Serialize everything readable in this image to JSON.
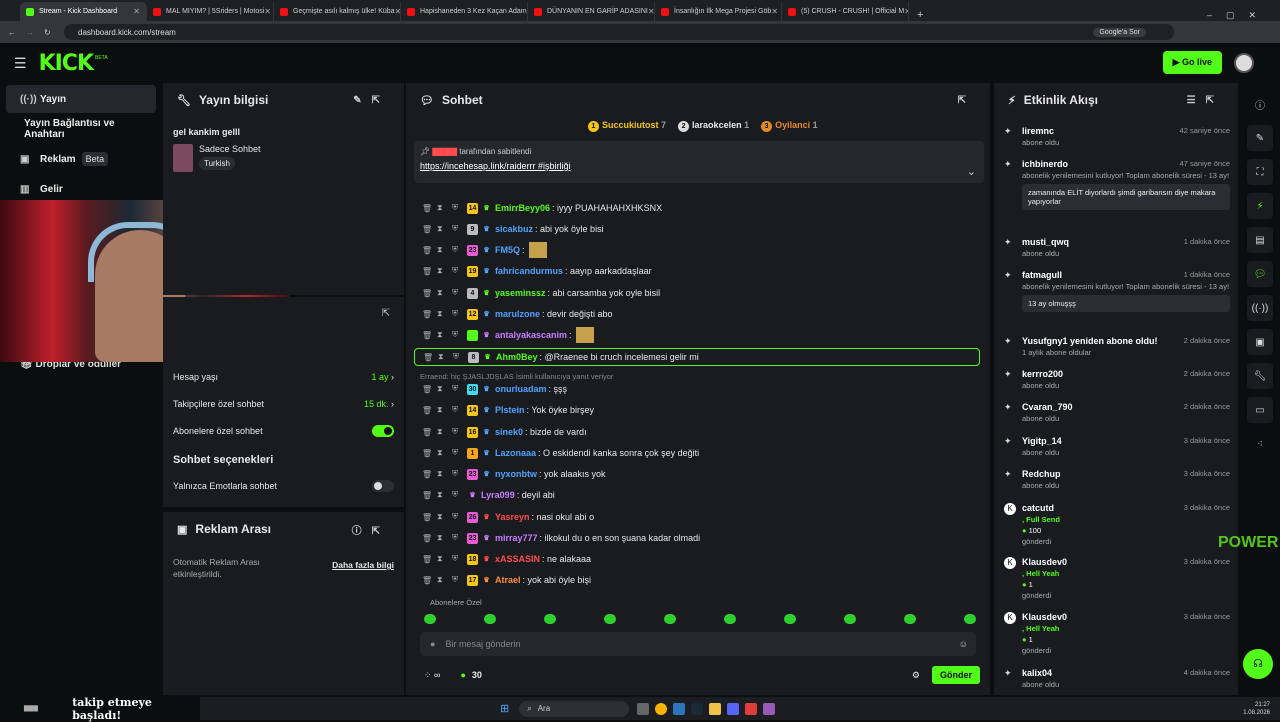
{
  "browser": {
    "tabs": [
      {
        "label": "Stream - Kick Dashboard",
        "active": true
      },
      {
        "label": "MAL MIYIM? | 5Sriders | Motosi"
      },
      {
        "label": "Geçmişte asılı kalmış ülke! Küba"
      },
      {
        "label": "Hapishaneden 3 Kez Kaçan Adam"
      },
      {
        "label": "DÜNYANIN EN GARİP ADASINI"
      },
      {
        "label": "İnsanlığın İlk Mega Projesi Göb"
      },
      {
        "label": "(5) CRUSH - CRUSH! | Official M"
      }
    ],
    "url": "dashboard.kick.com/stream",
    "google_btn": "Google'a Sor"
  },
  "header": {
    "logo": "KICK",
    "logo_sup": "BETA",
    "golive": "Go live"
  },
  "nav": {
    "items": [
      {
        "label": "Yayın",
        "icon": "broadcast-icon"
      },
      {
        "label": "Yayın Bağlantısı ve Anahtarı"
      },
      {
        "label": "Reklam",
        "badge": "Beta",
        "icon": "ad-icon"
      },
      {
        "label": "Gelir",
        "icon": "chart-icon"
      }
    ],
    "drops": "Droplar ve ödüller"
  },
  "stream_info": {
    "title": "Yayın bilgisi",
    "stream_title": "gel kankim gelll",
    "category": "Sadece Sohbet",
    "language": "Turkish"
  },
  "chat_settings": {
    "rows": [
      {
        "label": "Hesap yaşı",
        "value": "1 ay"
      },
      {
        "label": "Takipçilere özel sohbet",
        "value": "15 dk."
      },
      {
        "label": "Abonelere özel sohbet"
      }
    ],
    "section": "Sohbet seçenekleri",
    "emote_only": "Yalnızca Emotlarla sohbet"
  },
  "ad_break": {
    "title": "Reklam Arası",
    "desc": "Otomatik Reklam Arası etkinleştirildi.",
    "link": "Daha fazla bilgi"
  },
  "chat": {
    "title": "Sohbet",
    "top": [
      {
        "rank": "1",
        "name": "Succukiutost",
        "count": "7"
      },
      {
        "rank": "2",
        "name": "laraokcelen",
        "count": "1"
      },
      {
        "rank": "3",
        "name": "Oyilanci",
        "count": "1"
      }
    ],
    "pinned": {
      "by_suffix": "tarafından sabitlendi",
      "text": "https://incehesap.link/raiderrr #işbirliği"
    },
    "messages": [
      {
        "user": "EmirrBeyy06",
        "color": "#53fc18",
        "text": ": iyyy PUAHAHAHXHKSNX",
        "badge": "14",
        "bcol": "#f5c518"
      },
      {
        "user": "sicakbuz",
        "color": "#4fa3ff",
        "text": ": abi yok öyle bisi",
        "badge": "9",
        "bcol": "#bbbbbb"
      },
      {
        "user": "FM5Q",
        "color": "#4fa3ff",
        "text": ":",
        "badge": "23",
        "bcol": "#e85ad6"
      },
      {
        "user": "fahricandurmus",
        "color": "#4fa3ff",
        "text": ": aayıp aarkaddaşlaar",
        "badge": "19",
        "bcol": "#f5c518"
      },
      {
        "user": "yaseminssz",
        "color": "#53fc18",
        "text": ": abi carsamba yok oyle bisil",
        "badge": "4",
        "bcol": "#bbbbbb"
      },
      {
        "user": "marulzone",
        "color": "#4fa3ff",
        "text": ": devir değişti abo",
        "badge": "12",
        "bcol": "#f5c518"
      },
      {
        "user": "antalyakascanim",
        "color": "#c77dff",
        "text": ":",
        "badge": "",
        "bcol": "#53fc18"
      },
      {
        "user": "Ahm0Bey",
        "color": "#53fc18",
        "text": ": @Rraenee bi cruch incelemesi gelir mi",
        "badge": "8",
        "bcol": "#bbbbbb"
      },
      {
        "user": "onurluadam",
        "color": "#4fa3ff",
        "text": ": şşş",
        "badge": "30",
        "bcol": "#3ddcf5"
      },
      {
        "user": "Plstein",
        "color": "#4fa3ff",
        "text": ": Yok öyke birşey",
        "badge": "14",
        "bcol": "#f5c518"
      },
      {
        "user": "sinek0",
        "color": "#4fa3ff",
        "text": ": bizde de vardı",
        "badge": "16",
        "bcol": "#f5c518"
      },
      {
        "user": "Lazonaaa",
        "color": "#4fa3ff",
        "text": ": O eskidendi kanka sonra çok şey değiti",
        "badge": "1",
        "bcol": "#f5a518"
      },
      {
        "user": "nyxonbtw",
        "color": "#4fa3ff",
        "text": ": yok alaakıs yok",
        "badge": "23",
        "bcol": "#e85ad6"
      },
      {
        "user": "Lyra099",
        "color": "#c77dff",
        "text": ": deyil abi",
        "badge": "",
        "bcol": ""
      },
      {
        "user": "Yasreyn",
        "color": "#ff4d4d",
        "text": ": nasi okul abi o",
        "badge": "26",
        "bcol": "#e85ad6"
      },
      {
        "user": "mirray777",
        "color": "#c77dff",
        "text": ": ilkokul du o en son şuana kadar olmadi",
        "badge": "23",
        "bcol": "#e85ad6"
      },
      {
        "user": "xASSASIN",
        "color": "#ff4d4d",
        "text": ": ne alakaaa",
        "badge": "18",
        "bcol": "#f5c518"
      },
      {
        "user": "Atrael",
        "color": "#ff8c3a",
        "text": ": yok abi öyle bişi",
        "badge": "17",
        "bcol": "#f5c518"
      }
    ],
    "reply_note": "Erraend: hiç ŞJASLJDŞLAS İsimli kullanıcıya yanıt veriyor",
    "sub_label": "Abonelere Özel",
    "placeholder": "Bir mesaj gönderin",
    "points": "30",
    "send": "Gönder"
  },
  "activity": {
    "title": "Etkinlik Akışı",
    "items": [
      {
        "name": "liremnc",
        "sub": "abone oldu",
        "time": "42 saniye önce"
      },
      {
        "name": "ichbinerdo",
        "sub": "abonelik yenilemesini kutluyor! Toplam abonelik süresi - 13 ay!",
        "time": "47 saniye önce",
        "note": "zamanında ELİT diyorlardı şimdi garibansın diye makara yapıyorlar"
      },
      {
        "name": "musti_qwq",
        "sub": "abone oldu",
        "time": "1 dakika önce"
      },
      {
        "name": "fatmagull",
        "sub": "abonelik yenilemesini kutluyor! Toplam abonelik süresi - 13 ay!",
        "time": "1 dakika önce",
        "note": "13 ay olmuşşş"
      },
      {
        "name": "Yusufgny1 yeniden abone oldu!",
        "sub": "1 aylık abone oldular",
        "time": "2 dakika önce"
      },
      {
        "name": "kerrro200",
        "sub": "abone oldu",
        "time": "2 dakika önce"
      },
      {
        "name": "Cvaran_790",
        "sub": "abone oldu",
        "time": "2 dakika önce"
      },
      {
        "name": "Yigitp_14",
        "sub": "abone oldu",
        "time": "3 dakika önce"
      },
      {
        "name": "Redchup",
        "sub": "abone oldu",
        "time": "3 dakika önce"
      },
      {
        "name": "catcutd",
        "sub": ", Full Send",
        "sub2": "100",
        "sub3": "gönderdi",
        "time": "3 dakika önce"
      },
      {
        "name": "Klausdev0",
        "sub": ", Hell Yeah",
        "sub2": "1",
        "sub3": "gönderdi",
        "time": "3 dakika önce"
      },
      {
        "name": "Klausdev0",
        "sub": ", Hell Yeah",
        "sub2": "1",
        "sub3": "gönderdi",
        "time": "3 dakika önce"
      },
      {
        "name": "kalix04",
        "sub": "abone oldu",
        "time": "4 dakika önce"
      }
    ]
  },
  "overlay": {
    "power": "POWER",
    "follow": "takip etmeye başladı!"
  },
  "taskbar": {
    "search": "Ara",
    "time": "21:27",
    "date": "1.08.2026"
  }
}
